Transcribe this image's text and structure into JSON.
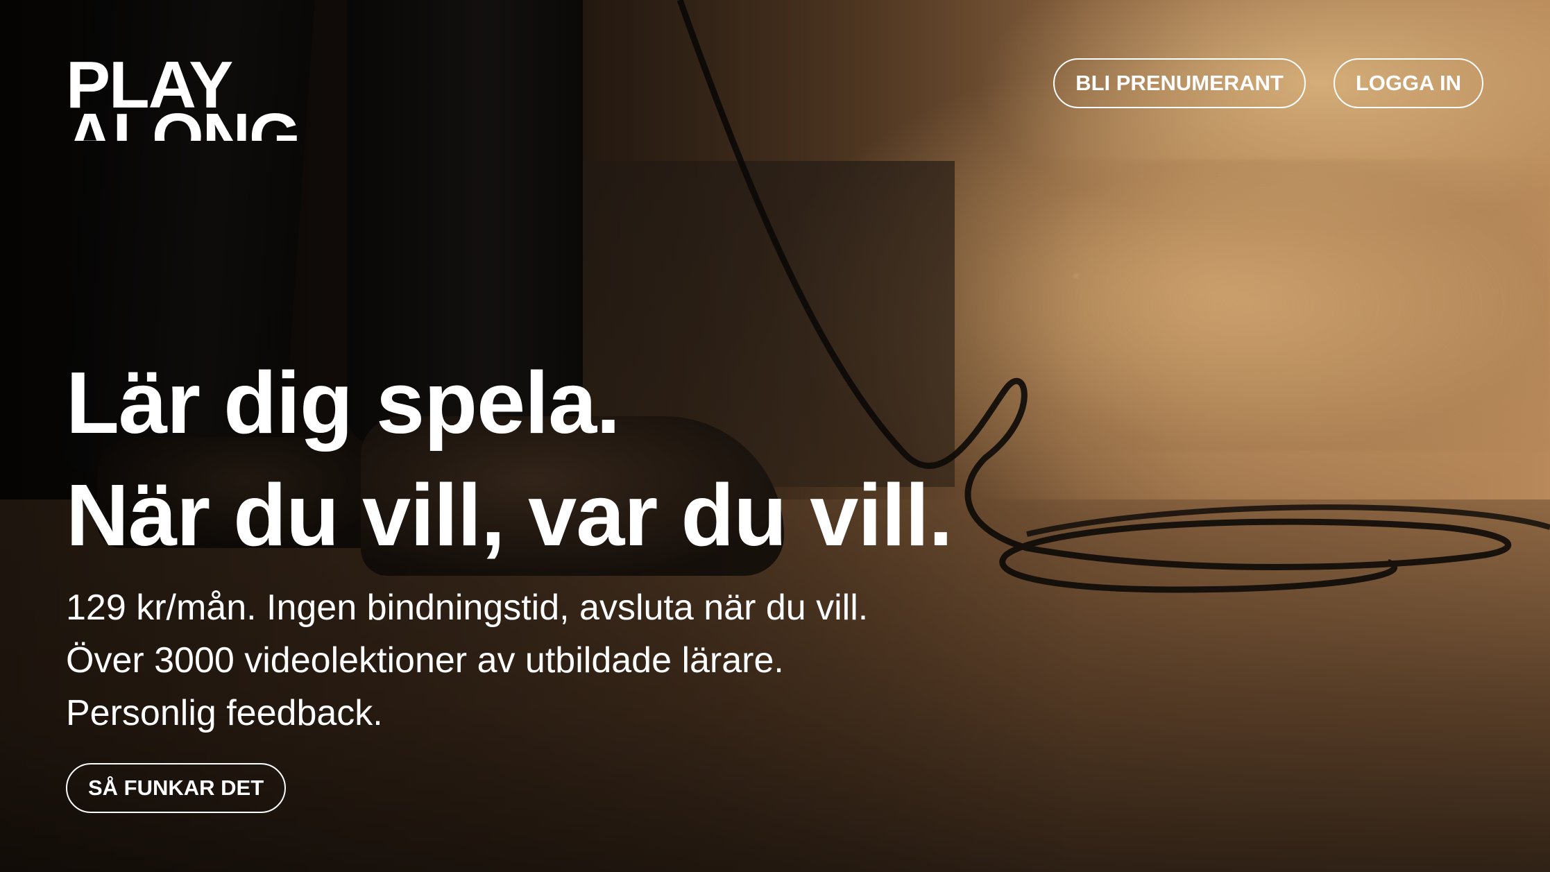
{
  "brand": {
    "logo_line1": "PLAY",
    "logo_line2": "ALONG"
  },
  "nav": {
    "subscribe_label": "BLI PRENUMERANT",
    "login_label": "LOGGA IN"
  },
  "hero": {
    "headline_line1": "Lär dig spela.",
    "headline_line2": "När du vill, var du vill.",
    "sub_line1": "129 kr/mån. Ingen bindningstid, avsluta när du vill.",
    "sub_line2": "Över 3000 videolektioner av utbildade lärare.",
    "sub_line3": "Personlig feedback.",
    "cta_label": "SÅ FUNKAR DET"
  },
  "colors": {
    "text": "#ffffff",
    "accent_warm": "#b8895a"
  }
}
